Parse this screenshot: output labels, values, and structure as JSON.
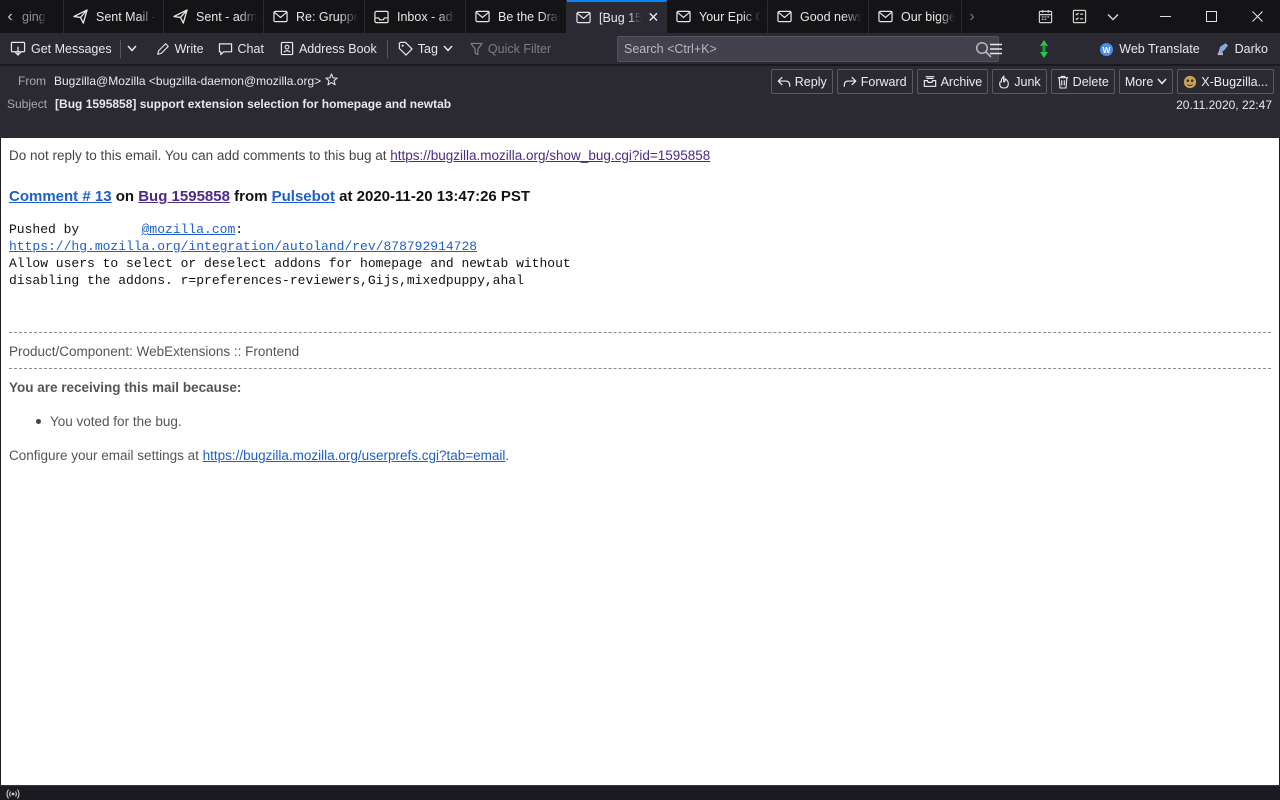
{
  "tabs": [
    {
      "label": "ging",
      "icon": "chat-icon",
      "active": false
    },
    {
      "label": "Sent Mail - ",
      "icon": "send-icon",
      "active": false
    },
    {
      "label": "Sent - adm",
      "icon": "send-icon",
      "active": false
    },
    {
      "label": "Re: Gruppe",
      "icon": "mail-icon",
      "active": false
    },
    {
      "label": "Inbox - adi",
      "icon": "inbox-icon",
      "active": false
    },
    {
      "label": "Be the Drag",
      "icon": "mail-icon",
      "active": false
    },
    {
      "label": "[Bug 15",
      "icon": "mail-icon",
      "active": true
    },
    {
      "label": "Your Epic G",
      "icon": "mail-icon",
      "active": false
    },
    {
      "label": "Good news",
      "icon": "mail-icon",
      "active": false
    },
    {
      "label": "Our bigges",
      "icon": "mail-icon",
      "active": false
    }
  ],
  "toolbar": {
    "get_messages": "Get Messages",
    "write": "Write",
    "chat": "Chat",
    "address_book": "Address Book",
    "tag": "Tag",
    "quick_filter": "Quick Filter",
    "search_placeholder": "Search <Ctrl+K>",
    "web_translate": "Web Translate",
    "user": "Darko"
  },
  "header": {
    "from_label": "From",
    "from_value": "Bugzilla@Mozilla <bugzilla-daemon@mozilla.org>",
    "subject_label": "Subject",
    "subject_value": "[Bug 1595858] support extension selection for homepage and newtab",
    "date": "20.11.2020, 22:47",
    "buttons": {
      "reply": "Reply",
      "forward": "Forward",
      "archive": "Archive",
      "junk": "Junk",
      "delete": "Delete",
      "more": "More",
      "xbugzilla": "X-Bugzilla..."
    }
  },
  "message": {
    "intro_text": "Do not reply to this email. You can add comments to this bug at ",
    "intro_link": "https://bugzilla.mozilla.org/show_bug.cgi?id=1595858",
    "comment_link": "Comment # 13",
    "on_text": " on ",
    "bug_link": "Bug 1595858",
    "from_text": " from ",
    "author_link": "Pulsebot",
    "at_text": " at 2020-11-20 13:47:26 PST",
    "pushed_by": "Pushed by        ",
    "pusher_link": "@mozilla.com",
    "pusher_suffix": ":",
    "rev_link": "https://hg.mozilla.org/integration/autoland/rev/878792914728",
    "commit_line1": "Allow users to select or deselect addons for homepage and newtab without",
    "commit_line2": "disabling the addons. r=preferences-reviewers,Gijs,mixedpuppy,ahal",
    "product": "Product/Component: WebExtensions :: Frontend",
    "receiving": "You are receiving this mail because:",
    "reason": "You voted for the bug.",
    "configure_text": "Configure your email settings at ",
    "configure_link": "https://bugzilla.mozilla.org/userprefs.cgi?tab=email",
    "configure_suffix": "."
  }
}
